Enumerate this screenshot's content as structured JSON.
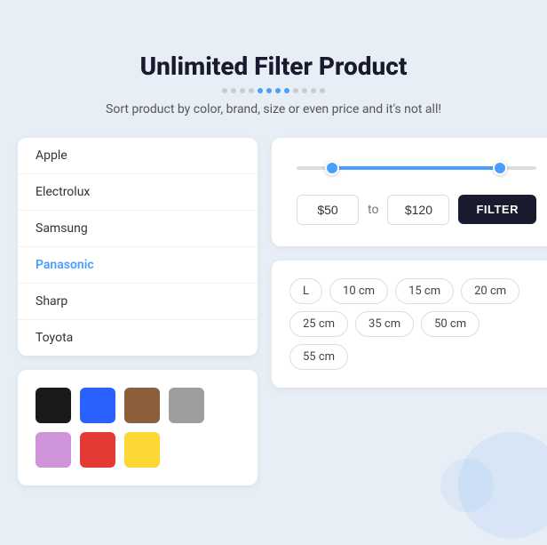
{
  "header": {
    "title": "Unlimited Filter Product",
    "subtitle": "Sort product by color, brand, size or even price and it's not all!",
    "dots": [
      {
        "active": false
      },
      {
        "active": false
      },
      {
        "active": false
      },
      {
        "active": false
      },
      {
        "active": true
      },
      {
        "active": true
      },
      {
        "active": true
      },
      {
        "active": true
      },
      {
        "active": false
      },
      {
        "active": false
      },
      {
        "active": false
      },
      {
        "active": false
      }
    ]
  },
  "brands": {
    "items": [
      {
        "label": "Apple",
        "active": false
      },
      {
        "label": "Electrolux",
        "active": false
      },
      {
        "label": "Samsung",
        "active": false
      },
      {
        "label": "Panasonic",
        "active": true
      },
      {
        "label": "Sharp",
        "active": false
      },
      {
        "label": "Toyota",
        "active": false
      }
    ]
  },
  "colors": {
    "items": [
      {
        "name": "black",
        "hex": "#1a1a1a"
      },
      {
        "name": "blue",
        "hex": "#2962ff"
      },
      {
        "name": "brown",
        "hex": "#8b5e3c"
      },
      {
        "name": "gray",
        "hex": "#9e9e9e"
      },
      {
        "name": "purple",
        "hex": "#ce93d8"
      },
      {
        "name": "red",
        "hex": "#e53935"
      },
      {
        "name": "yellow",
        "hex": "#fdd835"
      }
    ]
  },
  "price_filter": {
    "min_value": "$50",
    "max_value": "$120",
    "to_label": "to",
    "button_label": "FILTER",
    "track_left_pct": 15,
    "track_right_pct": 15
  },
  "sizes": {
    "items": [
      {
        "label": "L"
      },
      {
        "label": "10 cm"
      },
      {
        "label": "15 cm"
      },
      {
        "label": "20 cm"
      },
      {
        "label": "25 cm"
      },
      {
        "label": "35 cm"
      },
      {
        "label": "50 cm"
      },
      {
        "label": "55 cm"
      }
    ]
  }
}
